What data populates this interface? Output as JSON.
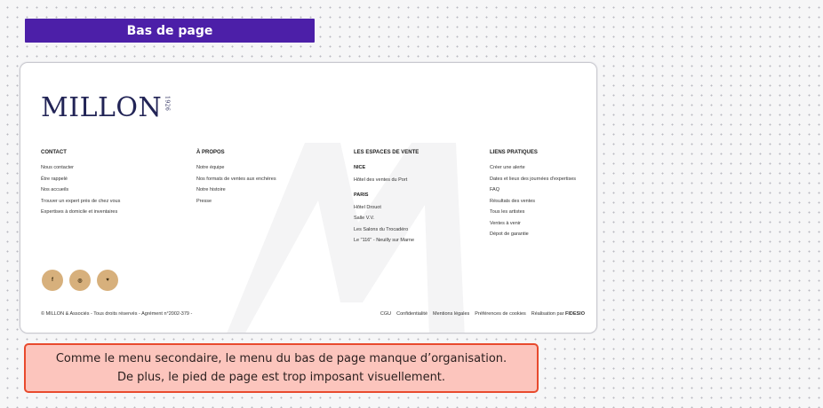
{
  "section_tag": "Bas de page",
  "footer": {
    "logo": {
      "text": "MILLON",
      "year": "1926"
    },
    "columns": [
      {
        "title": "CONTACT",
        "links": [
          "Nous contacter",
          "Être rappelé",
          "Nos accueils",
          "Trouver un expert près de chez vous",
          "Expertises à domicile et inventaires"
        ]
      },
      {
        "title": "À PROPOS",
        "links": [
          "Notre équipe",
          "Nos formats de ventes aux enchères",
          "Notre histoire",
          "Presse"
        ]
      },
      {
        "title": "LES ESPACES DE VENTE",
        "groups": [
          {
            "city": "NICE",
            "links": [
              "Hôtel des ventes du Port"
            ]
          },
          {
            "city": "PARIS",
            "links": [
              "Hôtel Drouot",
              "Salle V.V.",
              "Les Salons du Trocadéro",
              "Le \"116\" - Neuilly sur Marne"
            ]
          }
        ]
      },
      {
        "title": "LIENS PRATIQUES",
        "links": [
          "Créer une alerte",
          "Dates et lieux des journées d'expertises",
          "FAQ",
          "Résultats des ventes",
          "Tous les artistes",
          "Ventes à venir",
          "Dépot de garantie"
        ]
      }
    ],
    "socials": [
      {
        "icon": "facebook-icon",
        "glyph": "f"
      },
      {
        "icon": "instagram-icon",
        "glyph": "◎"
      },
      {
        "icon": "twitter-icon",
        "glyph": "♥"
      }
    ],
    "copyright": "© MILLON & Associés - Tous droits réservés - Agrément n°2002-379 -",
    "legal_links": [
      "CGU",
      "Confidentialité",
      "Mentions légales",
      "Préférences de cookies"
    ],
    "credit_prefix": "Réalisation par",
    "credit_name": "FIDESIO"
  },
  "annotation": {
    "line1": "Comme le menu secondaire, le menu du bas de page manque d’organisation.",
    "line2": "De plus, le pied de page est trop imposant visuellement."
  },
  "colors": {
    "tag_bg": "#4c1fa8",
    "social_bg": "#d7b07c",
    "note_bg": "#fcc5bd",
    "note_border": "#e84a2d",
    "logo": "#222456"
  }
}
